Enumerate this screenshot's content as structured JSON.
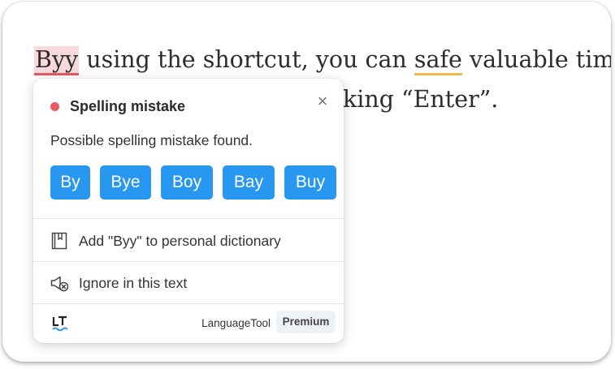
{
  "editor": {
    "line1": {
      "error_word": "Byy",
      "text_a": " using the shortcut, you can ",
      "style_word": "safe",
      "text_b": " valuable time."
    },
    "line2_visible": "king “Enter”."
  },
  "popup": {
    "title": "Spelling mistake",
    "close_symbol": "×",
    "message": "Possible spelling mistake found.",
    "suggestions": [
      "By",
      "Bye",
      "Boy",
      "Bay",
      "Buy"
    ],
    "actions": {
      "add_dictionary": "Add \"Byy\" to personal dictionary",
      "ignore": "Ignore in this text"
    },
    "footer": {
      "brand": "LanguageTool",
      "premium": "Premium"
    }
  },
  "colors": {
    "error_dot": "#e85a5f",
    "suggestion_bg": "#2897f0",
    "error_underline": "#e35a63",
    "style_underline": "#f2b84b"
  },
  "icons": {
    "close": "close-icon",
    "dictionary": "book-icon",
    "ignore": "megaphone-mute-icon",
    "logo": "languagetool-logo-icon"
  }
}
